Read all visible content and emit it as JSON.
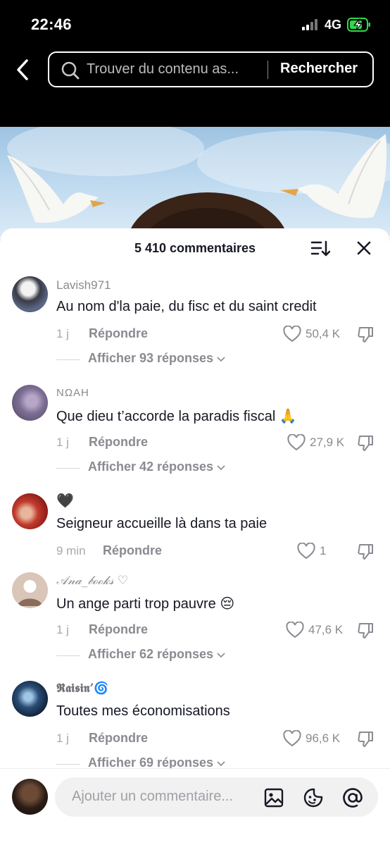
{
  "status_bar": {
    "time": "22:46",
    "network": "4G"
  },
  "search": {
    "placeholder": "Trouver du contenu as...",
    "button_label": "Rechercher"
  },
  "comments_header": {
    "title": "5 410 commentaires"
  },
  "comments": [
    {
      "username": "Lavish971",
      "text": "Au nom d'la paie, du fisc et du saint credit",
      "time": "1 j",
      "reply_label": "Répondre",
      "likes": "50,4 K",
      "replies_label": "Afficher 93 réponses"
    },
    {
      "username": "NΩAH",
      "text": "Que dieu t’accorde la paradis fiscal 🙏",
      "time": "1 j",
      "reply_label": "Répondre",
      "likes": "27,9 K",
      "replies_label": "Afficher 42 réponses"
    },
    {
      "username": "🖤",
      "text": "Seigneur accueille là dans ta paie",
      "time": "9 min",
      "reply_label": "Répondre",
      "likes": "1",
      "replies_label": ""
    },
    {
      "username": "𝒜𝓃𝒶_𝒷ℴℴ𝓀𝓈 ♡",
      "text": "Un ange parti trop pauvre 😔",
      "time": "1 j",
      "reply_label": "Répondre",
      "likes": "47,6 K",
      "replies_label": "Afficher 62 réponses"
    },
    {
      "username": "𝕽𝖆𝖎𝖘𝖎𝖓’🌀",
      "text": "Toutes mes économisations",
      "time": "1 j",
      "reply_label": "Répondre",
      "likes": "96,6 K",
      "replies_label": "Afficher 69 réponses"
    }
  ],
  "composer": {
    "placeholder": "Ajouter un commentaire..."
  },
  "icons": {
    "back": "chevron-left-icon",
    "search": "search-icon",
    "sort": "sort-icon",
    "close": "close-icon",
    "heart": "heart-icon",
    "dislike": "thumbs-down-icon",
    "chevron": "chevron-down-icon",
    "image": "image-icon",
    "sticker": "sticker-icon",
    "mention": "at-icon"
  },
  "colors": {
    "text": "#161823",
    "muted": "#8a8b91",
    "battery": "#32d74b"
  }
}
